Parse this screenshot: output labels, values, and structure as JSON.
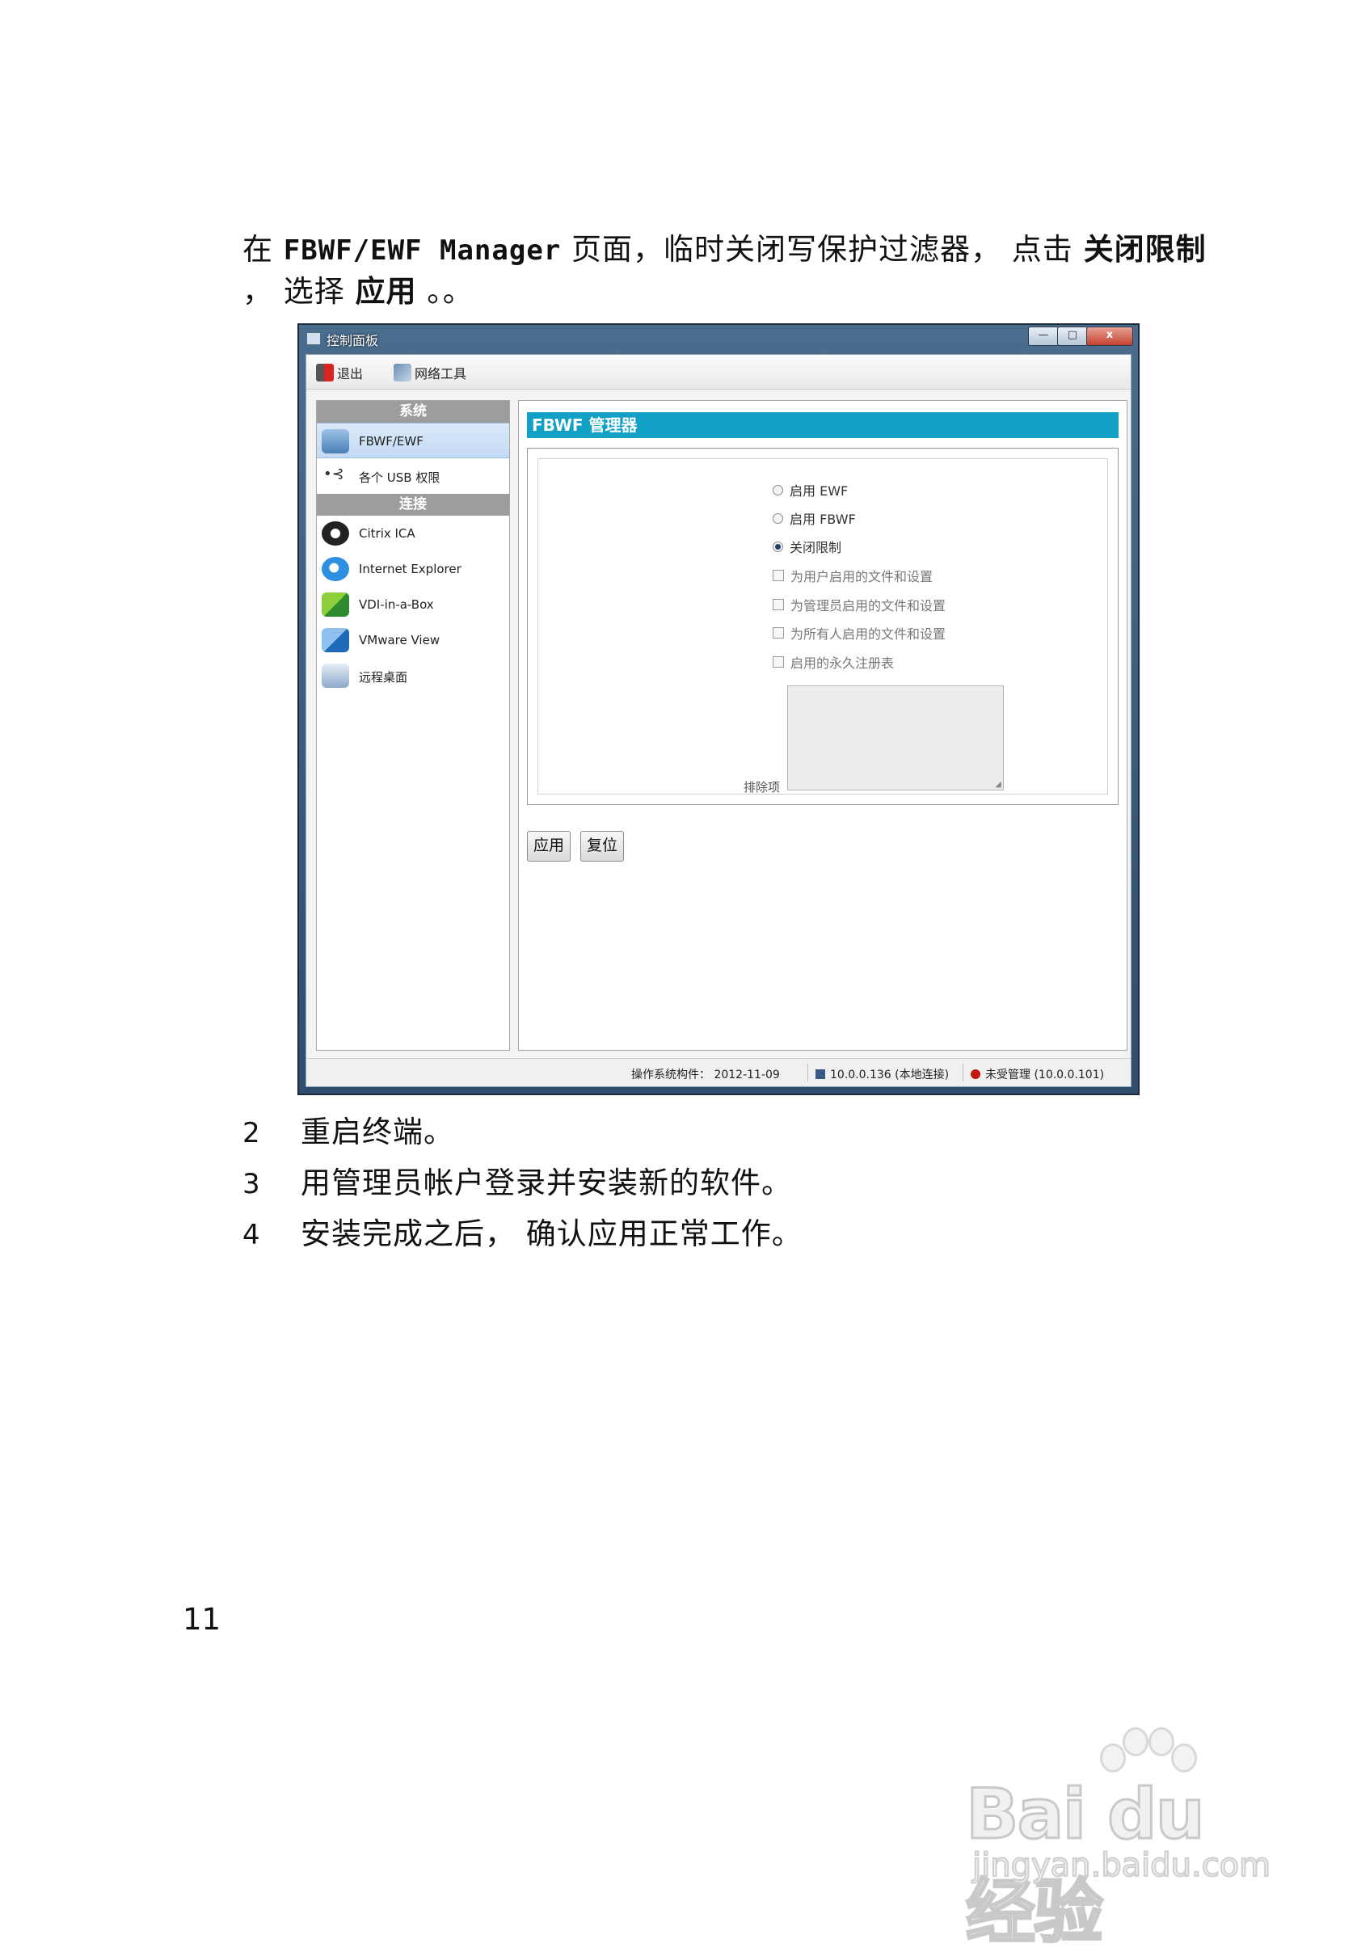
{
  "intro": {
    "p1": "在 ",
    "mono": "FBWF/EWF Manager",
    "p2": " 页面，临时关闭写保护过滤器， 点击 ",
    "b1": "关闭限制",
    "p3": " ， 选择 ",
    "b2": "应用",
    "p4": " 。。"
  },
  "window": {
    "title": "控制面板",
    "controls": {
      "min": "—",
      "max": "□",
      "close": "x"
    },
    "toolbar": {
      "exit": "退出",
      "network": "网络工具"
    },
    "sidebar": {
      "system_header": "系统",
      "system_items": [
        {
          "label": "FBWF/EWF",
          "icon": "disk-icon"
        },
        {
          "label": "各个 USB 权限",
          "icon": "usb-icon"
        }
      ],
      "connect_header": "连接",
      "connect_items": [
        {
          "label": "Citrix ICA",
          "icon": "citrix-icon"
        },
        {
          "label": "Internet Explorer",
          "icon": "ie-icon"
        },
        {
          "label": "VDI-in-a-Box",
          "icon": "vdi-icon"
        },
        {
          "label": "VMware View",
          "icon": "vmware-icon"
        },
        {
          "label": "远程桌面",
          "icon": "remote-desktop-icon"
        }
      ]
    },
    "panel": {
      "title": "FBWF 管理器",
      "options": [
        {
          "label": "启用 EWF",
          "type": "radio",
          "checked": false
        },
        {
          "label": "启用 FBWF",
          "type": "radio",
          "checked": false
        },
        {
          "label": "关闭限制",
          "type": "radio",
          "checked": true
        },
        {
          "label": "为用户启用的文件和设置",
          "type": "checkbox",
          "checked": false
        },
        {
          "label": "为管理员启用的文件和设置",
          "type": "checkbox",
          "checked": false
        },
        {
          "label": "为所有人启用的文件和设置",
          "type": "checkbox",
          "checked": false
        },
        {
          "label": "启用的永久注册表",
          "type": "checkbox",
          "checked": false
        }
      ],
      "exclusion_label": "排除项",
      "apply": "应用",
      "reset": "复位"
    },
    "status": {
      "os": "操作系统构件： 2012-11-09",
      "ip": "10.0.0.136 (本地连接)",
      "manager": "未受管理 (10.0.0.101)"
    }
  },
  "steps": [
    {
      "num": "2",
      "text": "重启终端。"
    },
    {
      "num": "3",
      "text": "用管理员帐户登录并安装新的软件。"
    },
    {
      "num": "4",
      "text": "安装完成之后， 确认应用正常工作。"
    }
  ],
  "page_number": "11",
  "watermark": {
    "brand": "Bai du 经验",
    "url": "jingyan.baidu.com"
  }
}
